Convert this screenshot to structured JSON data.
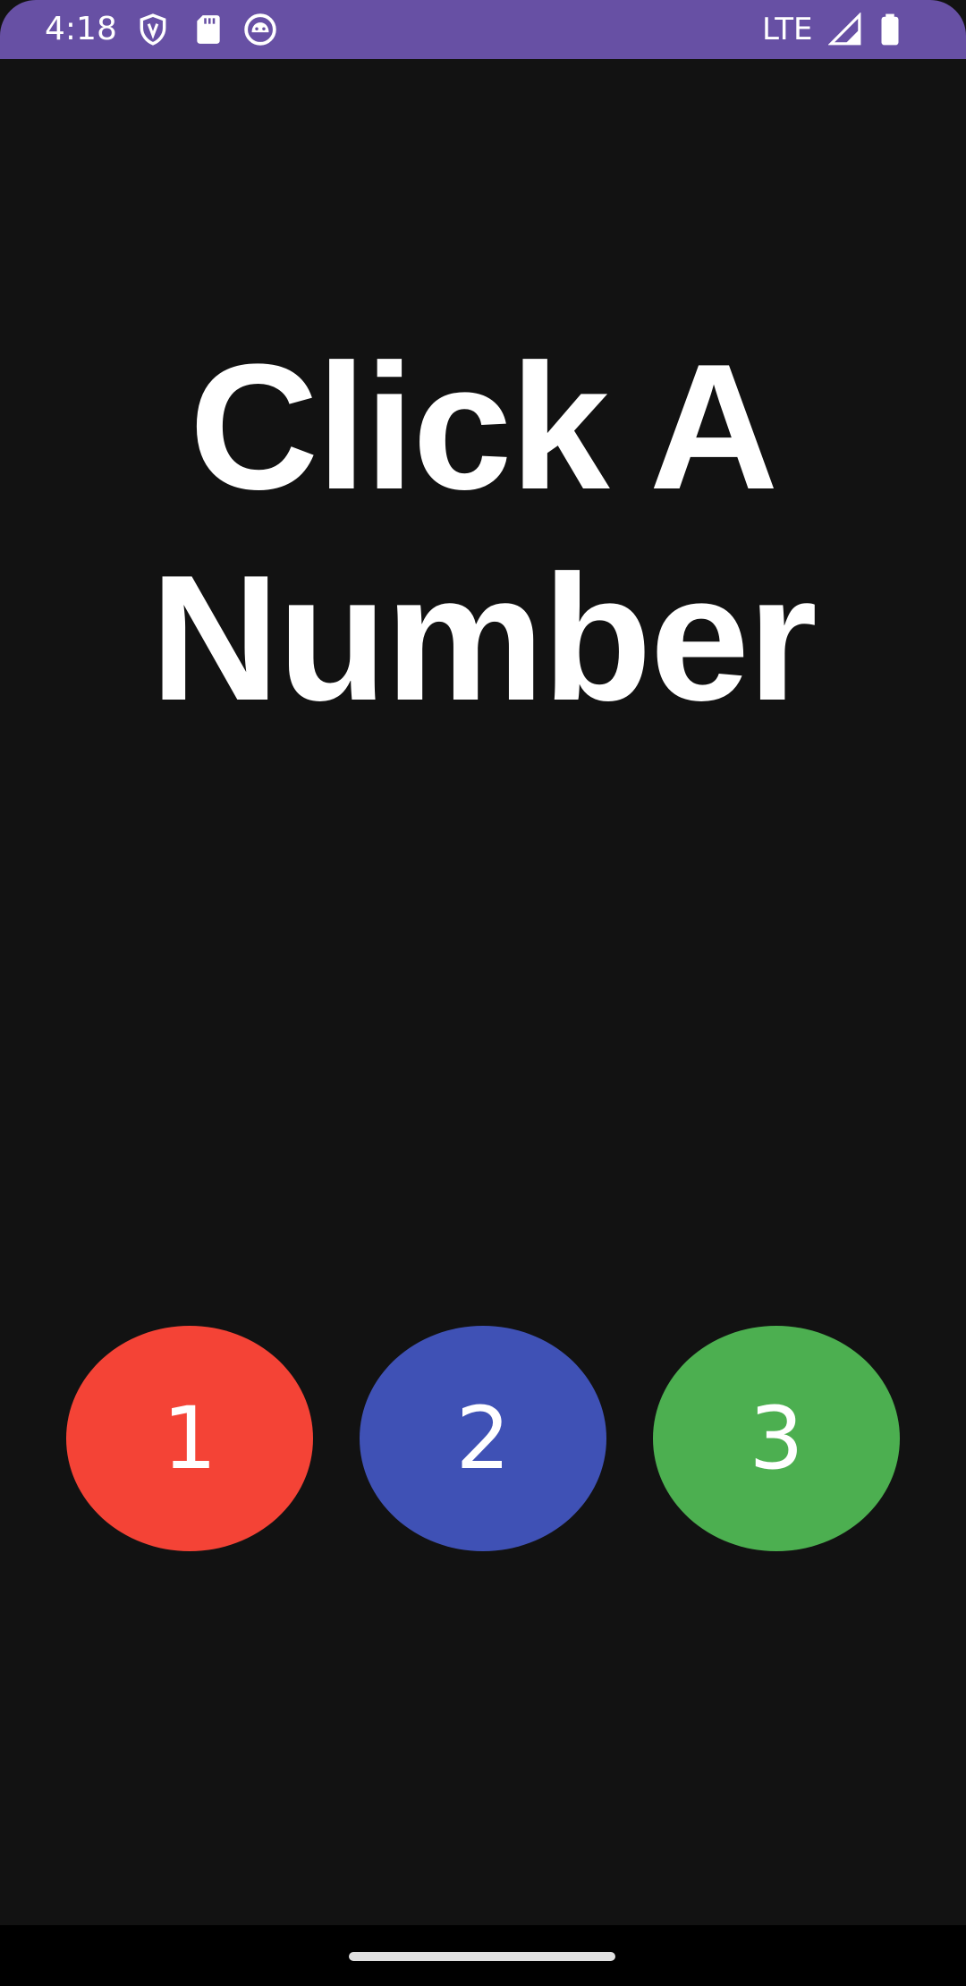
{
  "status_bar": {
    "time": "4:18",
    "network": "LTE",
    "icons": [
      "shield-icon",
      "sd-card-icon",
      "android-face-icon",
      "signal-icon",
      "battery-icon"
    ],
    "background_color": "#6750a4"
  },
  "main": {
    "title_line1": "Click A",
    "title_line2": "Number"
  },
  "buttons": [
    {
      "label": "1",
      "color": "#f44336"
    },
    {
      "label": "2",
      "color": "#3f51b5"
    },
    {
      "label": "3",
      "color": "#4caf50"
    }
  ],
  "theme": {
    "background": "#121212",
    "text": "#ffffff"
  }
}
